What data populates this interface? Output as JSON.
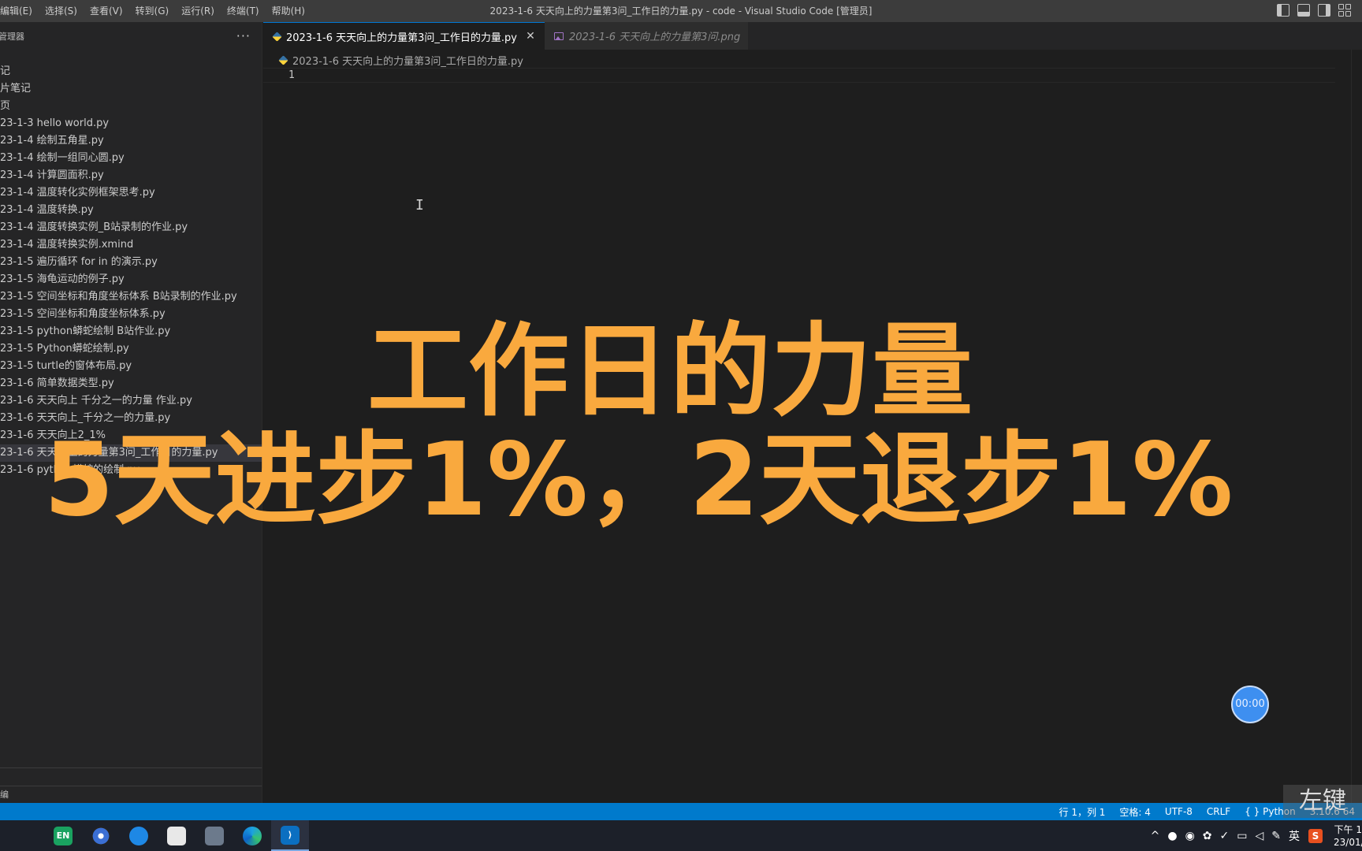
{
  "titlebar": {
    "menu": [
      "编辑(E)",
      "选择(S)",
      "查看(V)",
      "转到(G)",
      "运行(R)",
      "终端(T)",
      "帮助(H)"
    ],
    "window_title": "2023-1-6 天天向上的力量第3问_工作日的力量.py - code - Visual Studio Code [管理员]"
  },
  "sidebar": {
    "title": "管理器",
    "more": "···",
    "files": [
      "记",
      "片笔记",
      "页",
      "23-1-3 hello world.py",
      "23-1-4 绘制五角星.py",
      "23-1-4 绘制一组同心圆.py",
      "23-1-4 计算圆面积.py",
      "23-1-4 温度转化实例框架思考.py",
      "23-1-4 温度转换.py",
      "23-1-4 温度转换实例_B站录制的作业.py",
      "23-1-4 温度转换实例.xmind",
      "23-1-5 遍历循环 for in 的演示.py",
      "23-1-5 海龟运动的例子.py",
      "23-1-5 空间坐标和角度坐标体系 B站录制的作业.py",
      "23-1-5 空间坐标和角度坐标体系.py",
      "23-1-5 python蟒蛇绘制 B站作业.py",
      "23-1-5 Python蟒蛇绘制.py",
      "23-1-5 turtle的窗体布局.py",
      "23-1-6 简单数据类型.py",
      "23-1-6 天天向上 千分之一的力量 作业.py",
      "23-1-6 天天向上_千分之一的力量.py",
      "23-1-6 天天向上2_1%",
      "23-1-6 天天向上的力量第3问_工作日的力量.py",
      "23-1-6 python蟒蛇的绘制.py"
    ],
    "selected_index": 22,
    "outline_label": "编"
  },
  "editor": {
    "tabs": [
      {
        "label": "2023-1-6 天天向上的力量第3问_工作日的力量.py",
        "active": true
      },
      {
        "label": "2023-1-6 天天向上的力量第3问.png",
        "active": false
      }
    ],
    "breadcrumb": "2023-1-6 天天向上的力量第3问_工作日的力量.py",
    "line_number": "1",
    "cursor_glyph": "I"
  },
  "overlay": {
    "line1": "工作日的力量",
    "line2": "5天进步1%，2天退步1%",
    "color": "#f9a93e"
  },
  "timer": "00:00",
  "statusbar": {
    "position": "行 1，列 1",
    "spaces": "空格: 4",
    "encoding": "UTF-8",
    "eol": "CRLF",
    "language": "Python",
    "interpreter": "3.10.6 64"
  },
  "watermark": "左键",
  "taskbar": {
    "en_label": "EN",
    "ime_label": "英",
    "clock_time": "下午 1",
    "clock_date": "23/01/0"
  },
  "colors": {
    "statusbar": "#007acc",
    "sidebar": "#252526",
    "editor": "#1e1e1e",
    "accent": "#0078d4"
  }
}
